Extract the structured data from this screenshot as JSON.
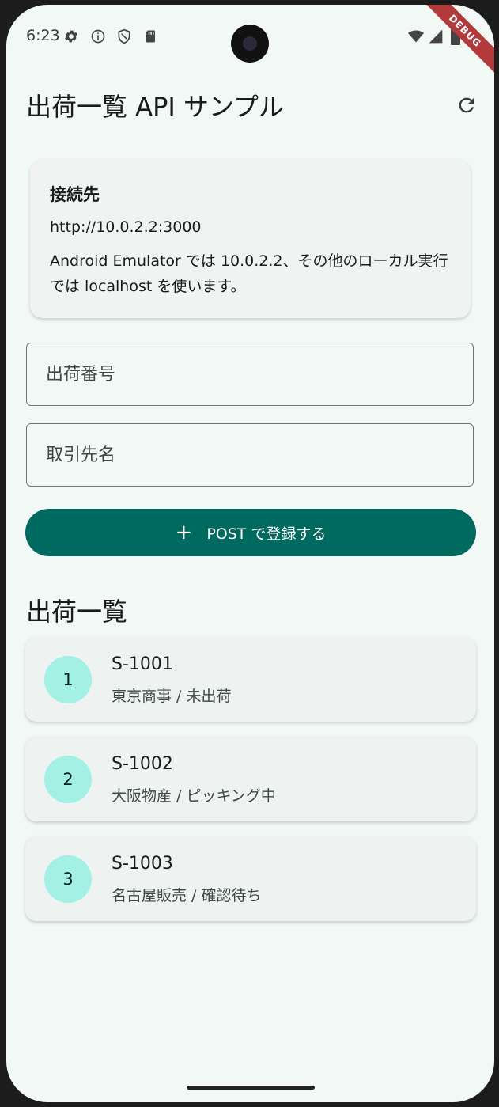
{
  "status_bar": {
    "time": "6:23",
    "debug_label": "DEBUG"
  },
  "app_bar": {
    "title": "出荷一覧 API サンプル"
  },
  "connection_card": {
    "title": "接続先",
    "url": "http://10.0.2.2:3000",
    "note": "Android Emulator では 10.0.2.2、その他のローカル実行では localhost を使います。"
  },
  "form": {
    "shipment_number_placeholder": "出荷番号",
    "customer_name_placeholder": "取引先名",
    "post_button_label": "POST で登録する"
  },
  "list": {
    "section_title": "出荷一覧",
    "items": [
      {
        "index": "1",
        "title": "S-1001",
        "subtitle": "東京商事 / 未出荷"
      },
      {
        "index": "2",
        "title": "S-1002",
        "subtitle": "大阪物産 / ピッキング中"
      },
      {
        "index": "3",
        "title": "S-1003",
        "subtitle": "名古屋販売 / 確認待ち"
      }
    ]
  },
  "colors": {
    "background": "#f1f8f6",
    "primary": "#006a60",
    "avatar": "#a3f0e4",
    "debug_ribbon": "#b23a3a"
  }
}
